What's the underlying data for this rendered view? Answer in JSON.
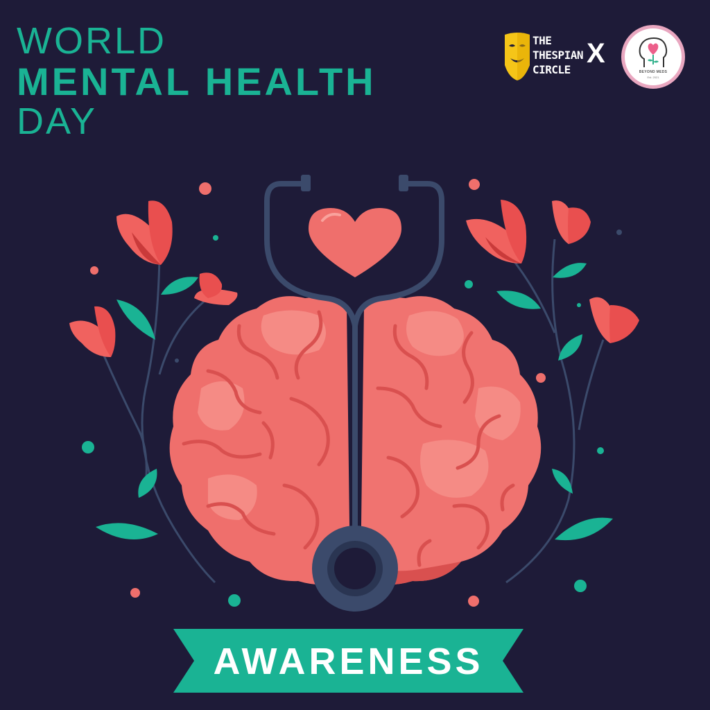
{
  "title": {
    "line1": "WORLD",
    "line2": "MENTAL HEALTH",
    "line3": "DAY"
  },
  "logos": {
    "thespian": {
      "line1": "THE",
      "line2": "THESPIAN",
      "line3": "CIRCLE",
      "icon": "theatre-mask-icon"
    },
    "separator": "X",
    "beyond_meds": {
      "name": "BEYOND MEDS",
      "est": "Est. 2021",
      "icon": "head-flower-heart-icon"
    }
  },
  "illustration": {
    "elements": [
      "brain-icon",
      "stethoscope-icon",
      "heart-icon",
      "tulip-icon",
      "leaf-icon"
    ]
  },
  "banner": {
    "label": "AWARENESS"
  },
  "colors": {
    "background": "#1e1b38",
    "teal": "#1ab394",
    "brain": "#ef6f6c",
    "brain_light": "#f58b85",
    "stethoscope": "#3b4a6b",
    "flower": "#e94f4f",
    "mask_yellow": "#f5c518"
  }
}
